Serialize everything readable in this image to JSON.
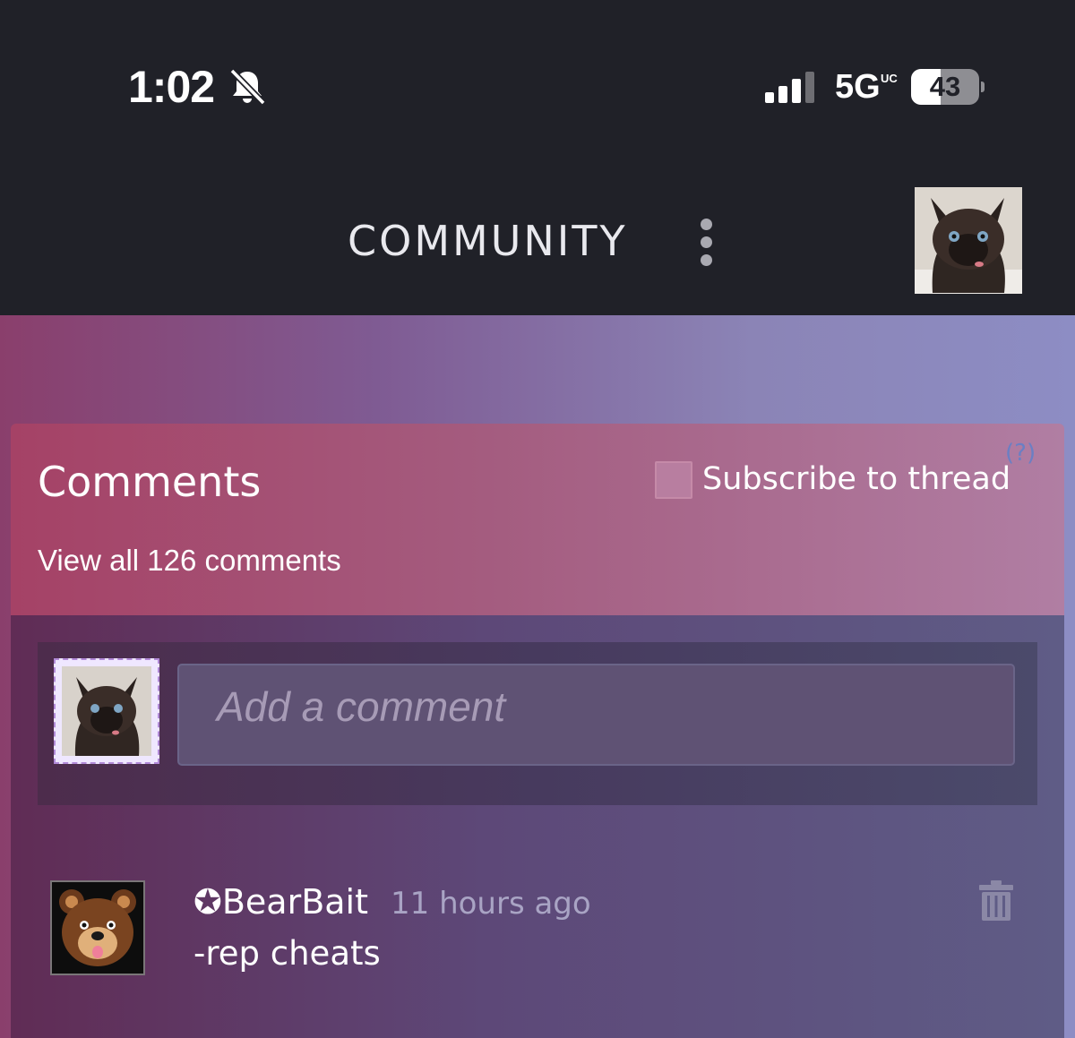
{
  "status_bar": {
    "time": "1:02",
    "network": "5G",
    "network_sub": "UC",
    "battery": "43",
    "battery_level": 0.43
  },
  "app_bar": {
    "title": "COMMUNITY"
  },
  "comments_panel": {
    "title": "Comments",
    "subscribe_label": "Subscribe to thread",
    "help_link": "(?)",
    "view_all": "View all 126 comments",
    "input_placeholder": "Add a comment"
  },
  "comments": [
    {
      "author": "✪BearBait",
      "time": "11 hours ago",
      "text": "-rep cheats"
    }
  ],
  "icons": [
    "bell-slash-icon",
    "signal-icon",
    "battery-icon",
    "kebab-menu-icon",
    "trash-icon"
  ]
}
